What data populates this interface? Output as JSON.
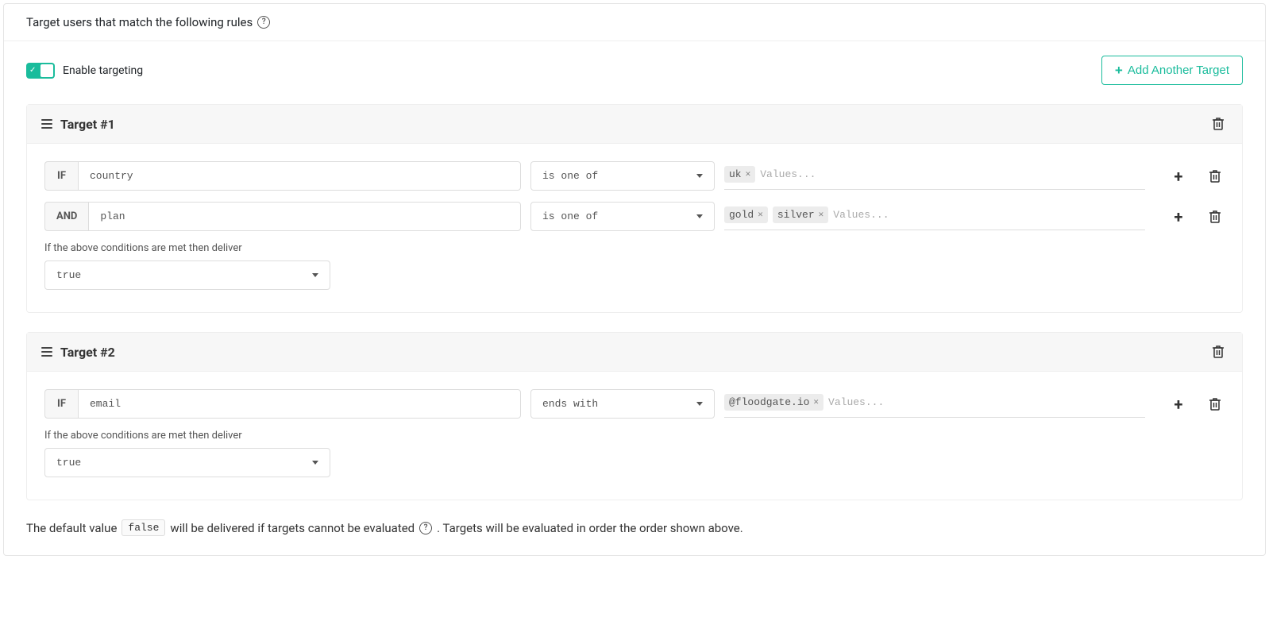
{
  "header": {
    "title": "Target users that match the following rules"
  },
  "toggle": {
    "label": "Enable targeting",
    "on": true
  },
  "add_button": {
    "label": "Add Another Target"
  },
  "values_placeholder": "Values...",
  "deliver_label": "If the above conditions are met then deliver",
  "targets": [
    {
      "title": "Target #1",
      "rules": [
        {
          "prefix": "IF",
          "attribute": "country",
          "operator": "is one of",
          "tags": [
            "uk"
          ]
        },
        {
          "prefix": "AND",
          "attribute": "plan",
          "operator": "is one of",
          "tags": [
            "gold",
            "silver"
          ]
        }
      ],
      "deliver": "true"
    },
    {
      "title": "Target #2",
      "rules": [
        {
          "prefix": "IF",
          "attribute": "email",
          "operator": "ends with",
          "tags": [
            "@floodgate.io"
          ]
        }
      ],
      "deliver": "true"
    }
  ],
  "footer": {
    "pre": "The default value",
    "value": "false",
    "mid": "will be delivered if targets cannot be evaluated",
    "post": ". Targets will be evaluated in order the order shown above."
  }
}
